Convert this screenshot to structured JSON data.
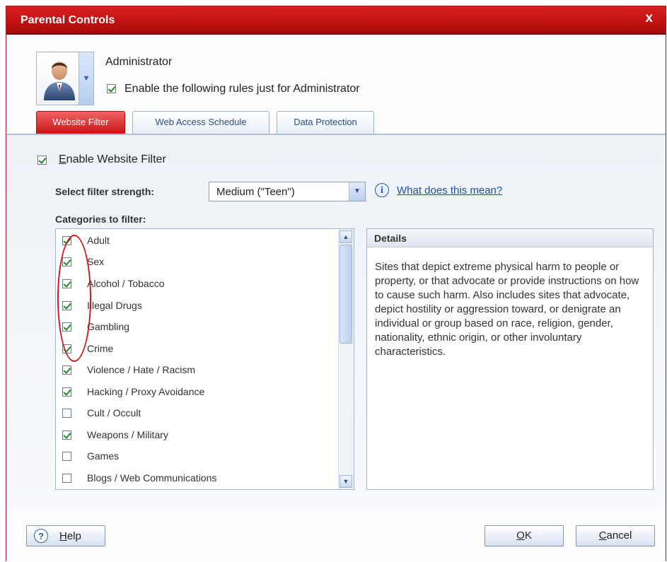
{
  "window": {
    "title": "Parental Controls",
    "close_label": "x"
  },
  "user": {
    "name": "Administrator",
    "enable_rules_label": "Enable the following rules just for Administrator",
    "enable_rules_checked": true
  },
  "tabs": [
    {
      "label": "Website Filter",
      "active": true
    },
    {
      "label": "Web Access Schedule",
      "active": false
    },
    {
      "label": "Data Protection",
      "active": false
    }
  ],
  "filter": {
    "enable_label_accel": "E",
    "enable_label_rest": "nable Website Filter",
    "enable_checked": true,
    "strength_label": "Select filter strength:",
    "strength_value": "Medium (\"Teen\")",
    "info_link": "What does this mean?",
    "categories_label": "Categories to filter:"
  },
  "categories": [
    {
      "label": "Adult",
      "checked": true
    },
    {
      "label": "Sex",
      "checked": true
    },
    {
      "label": "Alcohol / Tobacco",
      "checked": true
    },
    {
      "label": "Illegal Drugs",
      "checked": true
    },
    {
      "label": "Gambling",
      "checked": true
    },
    {
      "label": "Crime",
      "checked": true
    },
    {
      "label": "Violence / Hate / Racism",
      "checked": true
    },
    {
      "label": "Hacking / Proxy Avoidance",
      "checked": true
    },
    {
      "label": "Cult / Occult",
      "checked": false
    },
    {
      "label": "Weapons / Military",
      "checked": true
    },
    {
      "label": "Games",
      "checked": false
    },
    {
      "label": "Blogs / Web Communications",
      "checked": false
    }
  ],
  "details": {
    "header": "Details",
    "text": "Sites that depict extreme physical harm to people or property, or that advocate or provide instructions on how to cause such harm. Also includes sites that advocate, depict hostility or aggression toward, or denigrate an individual or group based on race, religion, gender, nationality, ethnic origin, or other involuntary characteristics."
  },
  "buttons": {
    "help_accel": "H",
    "help_rest": "elp",
    "ok_accel": "O",
    "ok_rest": "K",
    "cancel_accel": "C",
    "cancel_rest": "ancel"
  },
  "colors": {
    "title_bar": "#c81414",
    "active_tab": "#d92020",
    "link": "#1f4fa3",
    "annotation_circle": "#d11a1a"
  }
}
